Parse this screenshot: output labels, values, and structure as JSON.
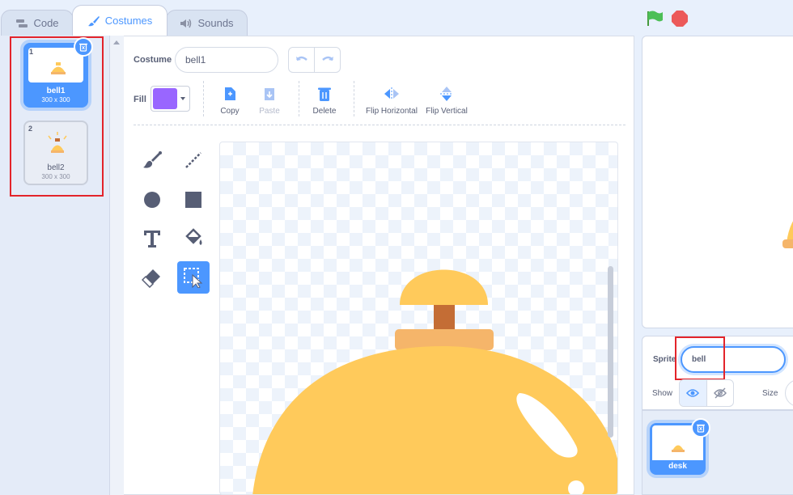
{
  "tabs": [
    {
      "label": "Code",
      "icon": "code-blocks-icon"
    },
    {
      "label": "Costumes",
      "icon": "paintbrush-icon",
      "active": true
    },
    {
      "label": "Sounds",
      "icon": "speaker-icon"
    }
  ],
  "costumes": [
    {
      "number": "1",
      "name": "bell1",
      "size": "300 x 300",
      "selected": true
    },
    {
      "number": "2",
      "name": "bell2",
      "size": "300 x 300",
      "selected": false
    }
  ],
  "editor": {
    "costume_label": "Costume",
    "costume_name": "bell1",
    "fill_label": "Fill",
    "fill_color": "#9966ff",
    "actions": {
      "copy": "Copy",
      "paste": "Paste",
      "delete": "Delete",
      "flip_h": "Flip Horizontal",
      "flip_v": "Flip Vertical"
    },
    "tools": [
      "brush-icon",
      "line-icon",
      "circle-icon",
      "rectangle-icon",
      "text-icon",
      "fill-bucket-icon",
      "eraser-icon",
      "select-icon"
    ],
    "selected_tool": "select-icon"
  },
  "sprite_info": {
    "sprite_label": "Sprite",
    "sprite_name": "bell",
    "show_label": "Show",
    "size_label": "Size"
  },
  "sprites": [
    {
      "name": "desk"
    }
  ],
  "colors": {
    "accent": "#4c97ff",
    "bell_body": "#ffca5b",
    "bell_base": "#f5b56a",
    "bell_stem": "#c46d35",
    "highlight_box": "#e3242b"
  }
}
